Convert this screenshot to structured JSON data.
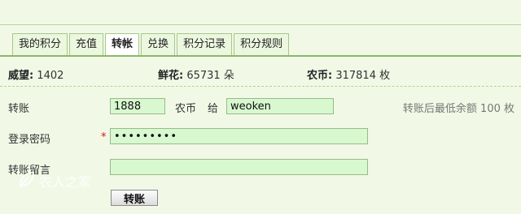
{
  "tabs": [
    {
      "label": "我的积分",
      "active": false
    },
    {
      "label": "充值",
      "active": false
    },
    {
      "label": "转帐",
      "active": true
    },
    {
      "label": "兑换",
      "active": false
    },
    {
      "label": "积分记录",
      "active": false
    },
    {
      "label": "积分规则",
      "active": false
    }
  ],
  "stats": {
    "prestige_label": "威望:",
    "prestige_value": "1402",
    "flowers_label": "鲜花:",
    "flowers_value": "65731 朵",
    "coins_label": "农币:",
    "coins_value": "317814 枚"
  },
  "form": {
    "transfer_label": "转账",
    "amount_value": "1888",
    "currency_text": "农币",
    "to_text": "给",
    "recipient_value": "weoken",
    "min_balance_hint": "转账后最低余额  100 枚",
    "password_label": "登录密码",
    "required_mark": "*",
    "password_value": "•••••••••",
    "message_label": "转账留言",
    "message_value": "",
    "submit_label": "转账"
  },
  "watermark": {
    "text": "农人之家",
    "icon": "leaf-logo-icon"
  },
  "colors": {
    "background": "#f1f9e6",
    "input_bg": "#d8f8d0",
    "tab_border": "#a5c889",
    "required": "#dd1111"
  }
}
